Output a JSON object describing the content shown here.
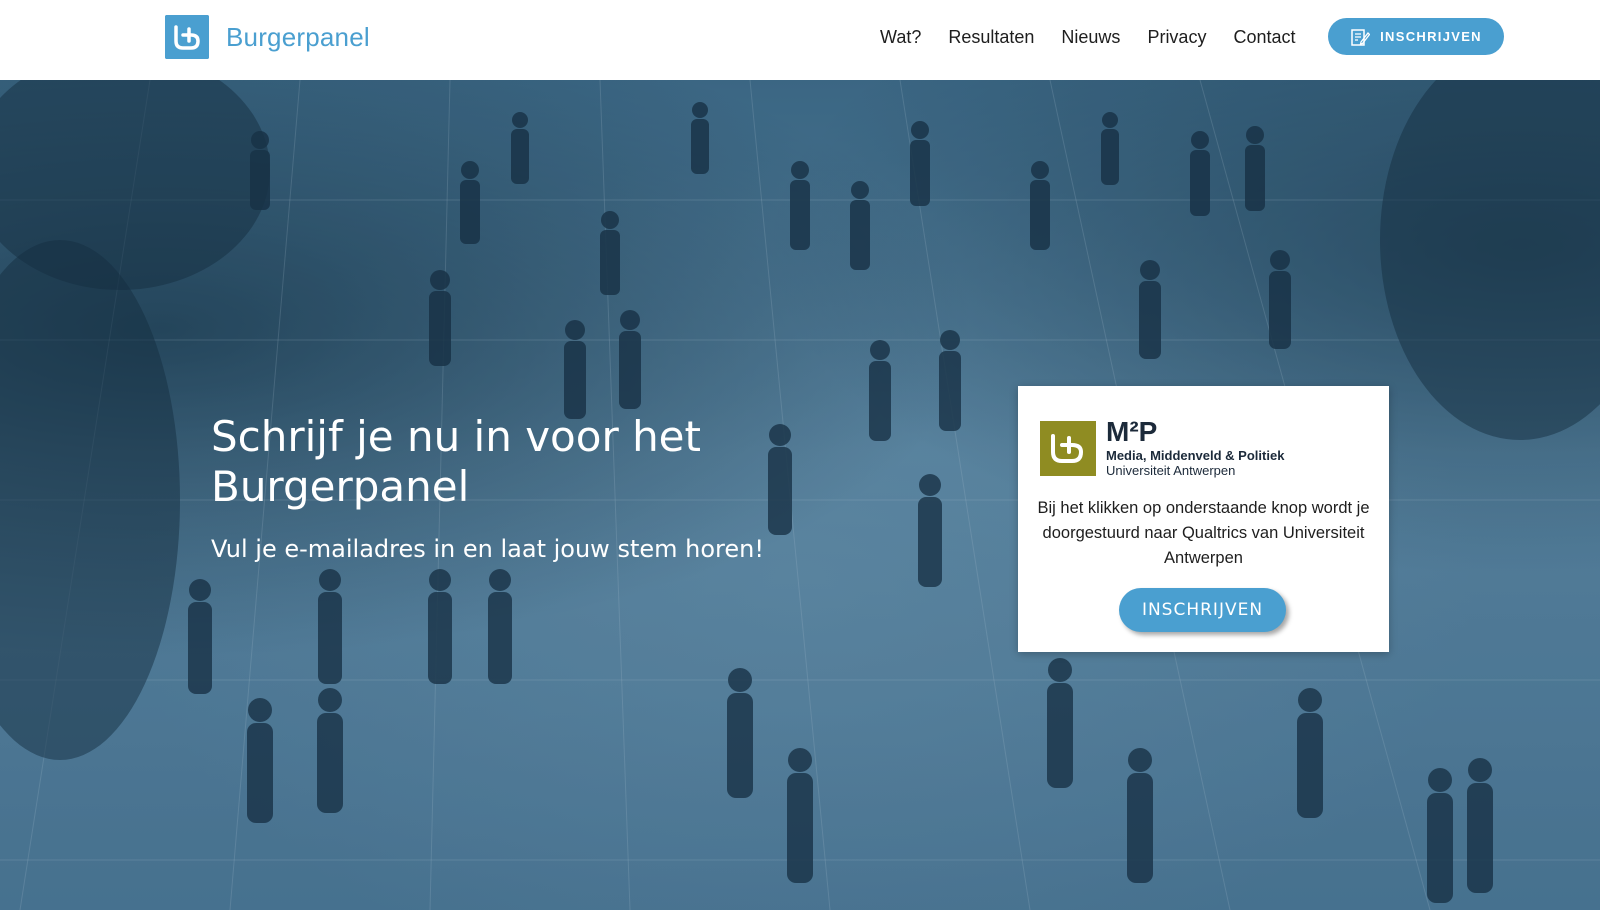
{
  "header": {
    "brand": "Burgerpanel",
    "nav": [
      "Wat?",
      "Resultaten",
      "Nieuws",
      "Privacy",
      "Contact"
    ],
    "cta_label": "INSCHRIJVEN",
    "cta_icon": "edit-document-icon",
    "logo_icon": "burgerpanel-logo-icon"
  },
  "hero": {
    "title": "Schrijf je nu in voor het Burgerpanel",
    "subtitle": "Vul je e-mailadres in en laat jouw stem horen!"
  },
  "card": {
    "org_title": "M²P",
    "org_line1": "Media, Middenveld & Politiek",
    "org_line2": "Universiteit Antwerpen",
    "text": "Bij het klikken op onderstaande knop wordt je doorgestuurd naar Qualtrics van Universiteit Antwerpen",
    "button_label": "INSCHRIJVEN",
    "logo_icon": "m2p-logo-icon"
  },
  "colors": {
    "brand_blue": "#4a9fd0",
    "header_bg": "#ffffff",
    "overlay_blue": "#3f6b88",
    "m2p_olive": "#8f8c22",
    "text_dark": "#1e1e1e"
  }
}
